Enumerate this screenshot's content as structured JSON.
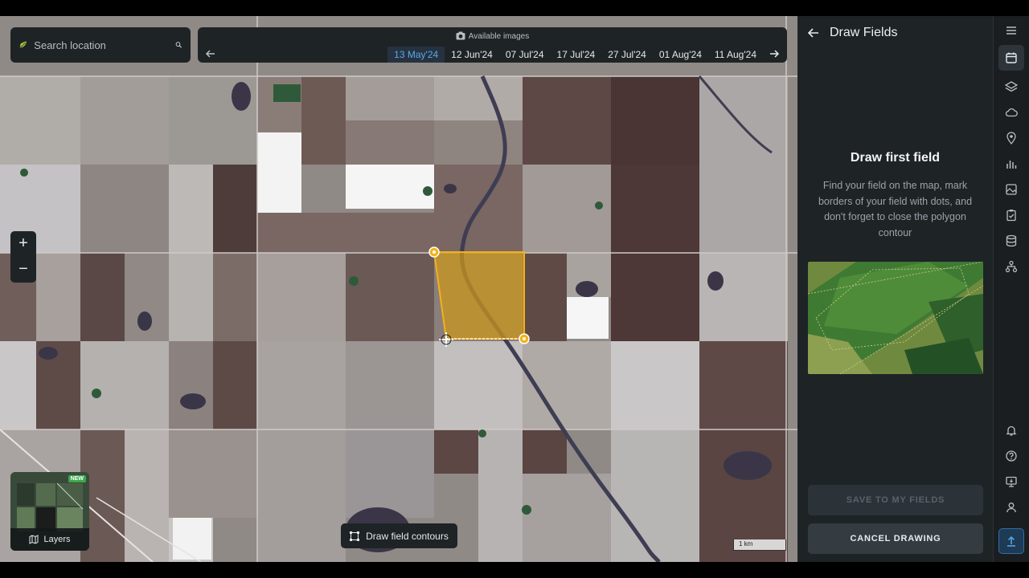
{
  "search": {
    "placeholder": "Search location"
  },
  "timeline": {
    "header": "Available images",
    "dates": [
      "13 May'24",
      "12 Jun'24",
      "07 Jul'24",
      "17 Jul'24",
      "27 Jul'24",
      "01 Aug'24",
      "11 Aug'24"
    ],
    "active_index": 0
  },
  "zoom": {
    "in": "+",
    "out": "−"
  },
  "layers": {
    "label": "Layers",
    "badge": "NEW"
  },
  "draw_button": {
    "label": "Draw field contours"
  },
  "scale": {
    "label": "1 km"
  },
  "panel": {
    "title": "Draw Fields",
    "heading": "Draw first field",
    "description": "Find your field on the map, mark borders of your field with dots, and don't forget to close the polygon contour",
    "save_label": "SAVE TO MY FIELDS",
    "cancel_label": "CANCEL DRAWING"
  },
  "colors": {
    "accent": "#5aa9e6",
    "polygon_stroke": "#f2b21c",
    "polygon_fill": "#c9961e",
    "new_badge": "#3ba84a"
  },
  "rail_icons": [
    "menu-icon",
    "calendar-icon",
    "layers-icon",
    "cloud-icon",
    "location-pin-icon",
    "bar-chart-icon",
    "image-icon",
    "clipboard-check-icon",
    "database-icon",
    "network-icon",
    "bell-icon",
    "help-icon",
    "monitor-icon",
    "user-icon",
    "upload-icon"
  ]
}
